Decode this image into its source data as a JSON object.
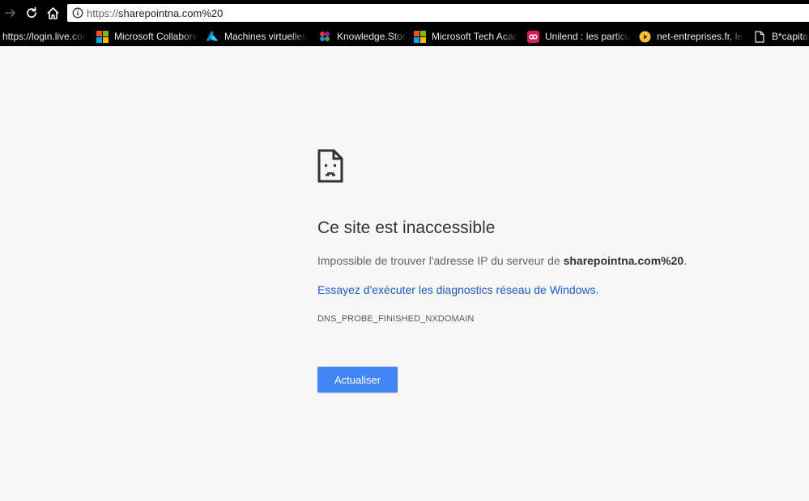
{
  "browser": {
    "url_scheme": "https://",
    "url_host": "sharepointna.com%20",
    "bookmarks": [
      {
        "label": "https://login.live.com",
        "icon": "none"
      },
      {
        "label": "Microsoft Collaborer",
        "icon": "microsoft-logo-icon"
      },
      {
        "label": "Machines virtuelles -",
        "icon": "azure-logo-icon"
      },
      {
        "label": "Knowledge.Store",
        "icon": "knowledge-store-icon"
      },
      {
        "label": "Microsoft Tech Academy",
        "icon": "microsoft-logo-icon"
      },
      {
        "label": "Unilend : les particuliers",
        "icon": "unilend-icon"
      },
      {
        "label": "net-entreprises.fr, le site",
        "icon": "net-entreprises-icon"
      },
      {
        "label": "B*capital s",
        "icon": "page-icon"
      }
    ]
  },
  "error_page": {
    "title": "Ce site est inaccessible",
    "description_prefix": "Impossible de trouver l'adresse IP du serveur de ",
    "description_host": "sharepointna.com%20",
    "description_suffix": ".",
    "diagnostics_link": "Essayez d'exécuter les diagnostics réseau de Windows.",
    "error_code": "DNS_PROBE_FINISHED_NXDOMAIN",
    "reload_label": "Actualiser"
  },
  "colors": {
    "toolbar_bg": "#000000",
    "page_bg": "#f7f7f7",
    "button_bg": "#4285f4",
    "link": "#1a59c6",
    "microsoft_red": "#f25022",
    "microsoft_green": "#7fba00",
    "microsoft_blue": "#00a4ef",
    "microsoft_yellow": "#ffb900"
  }
}
